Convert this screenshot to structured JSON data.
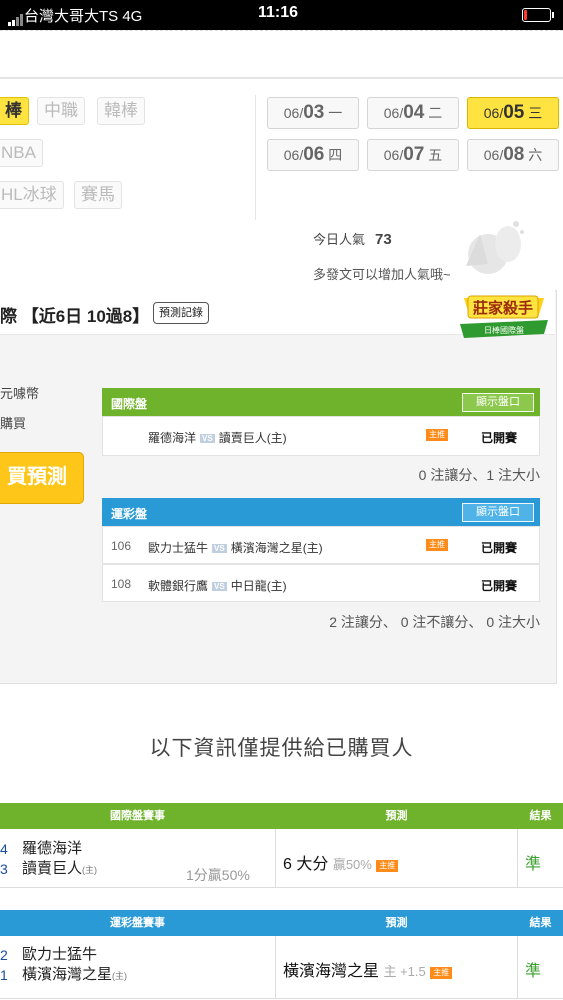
{
  "status_bar": {
    "carrier": "台灣大哥大TS  4G",
    "time": "11:16"
  },
  "sports": {
    "baseball": "棒",
    "cpbl": "中職",
    "kbo": "韓棒",
    "nba": "NBA",
    "nhl": "HL冰球",
    "horse": "賽馬"
  },
  "dates": [
    {
      "prefix": "06/",
      "day": "03",
      "weekday": "一"
    },
    {
      "prefix": "06/",
      "day": "04",
      "weekday": "二"
    },
    {
      "prefix": "06/",
      "day": "05",
      "weekday": "三"
    },
    {
      "prefix": "06/",
      "day": "06",
      "weekday": "四"
    },
    {
      "prefix": "06/",
      "day": "07",
      "weekday": "五"
    },
    {
      "prefix": "06/",
      "day": "08",
      "weekday": "六"
    }
  ],
  "popularity": {
    "label": "今日人氣",
    "value": "73",
    "hint": "多發文可以增加人氣哦~"
  },
  "panel": {
    "title": "際 【近6日 10過8】",
    "record_btn": "預測記錄",
    "badge_title": "莊家殺手",
    "badge_sub": "日棒國際盤",
    "currency": "元噱幣",
    "buy_text": "購買",
    "buy_btn": "買預測"
  },
  "intl": {
    "label": "國際盤",
    "show_btn": "顯示盤口",
    "rows": [
      {
        "no": "",
        "away": "羅德海洋",
        "home": "讀賣巨人(主)",
        "status": "已開賽"
      }
    ],
    "summary": "0 注讓分、1 注大小"
  },
  "lottery": {
    "label": "運彩盤",
    "show_btn": "顯示盤口",
    "rows": [
      {
        "no": "106",
        "away": "歐力士猛牛",
        "home": "橫濱海灣之星(主)",
        "status": "已開賽"
      },
      {
        "no": "108",
        "away": "軟體銀行鷹",
        "home": "中日龍(主)",
        "status": "已開賽"
      }
    ],
    "summary": "2 注讓分、 0 注不讓分、 0 注大小"
  },
  "info_title": "以下資訊僅提供給已購買人",
  "intl_table": {
    "headers": {
      "game": "國際盤賽事",
      "pred": "預測",
      "result": "結果"
    },
    "row": {
      "n1": "4",
      "n2": "3",
      "away": "羅德海洋",
      "home": "讀賣巨人",
      "home_tag": "(主)",
      "odds": "1分贏50%",
      "pred": "6 大分",
      "pred_sub": "贏50%",
      "result": "準"
    }
  },
  "lottery_table": {
    "headers": {
      "game": "運彩盤賽事",
      "pred": "預測",
      "result": "結果"
    },
    "row": {
      "n1": "2",
      "n2": "1",
      "away": "歐力士猛牛",
      "home": "橫濱海灣之星",
      "home_tag": "(主)",
      "pred": "橫濱海灣之星",
      "pred_sub": "主 +1.5",
      "result": "準"
    }
  },
  "star_label": "主推",
  "vs_label": "VS",
  "colors": {
    "accent_yellow": "#ffe340",
    "green": "#6fb22b",
    "blue": "#2a9ad6",
    "orange": "#ff8c1a"
  }
}
